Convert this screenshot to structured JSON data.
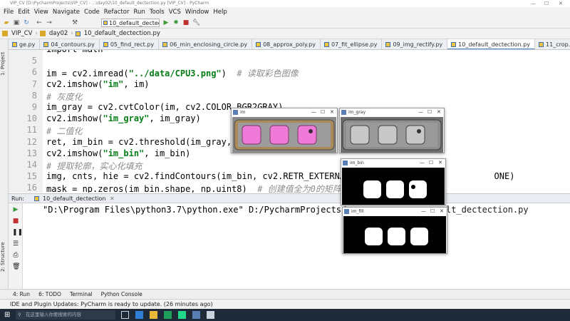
{
  "window": {
    "title": "VIP_CV [D:\\PycharmProjects\\VIP_CV] - ...\\day02\\10_default_dectection.py [VIP_CV] - PyCharm"
  },
  "menu": [
    "File",
    "Edit",
    "View",
    "Navigate",
    "Code",
    "Refactor",
    "Run",
    "Tools",
    "VCS",
    "Window",
    "Help"
  ],
  "toolbar": {
    "run_config": "10_default_dectection"
  },
  "breadcrumb": [
    "VIP_CV",
    "day02",
    "10_default_dectection.py"
  ],
  "tabs": [
    {
      "label": "ge.py",
      "active": false
    },
    {
      "label": "04_contours.py",
      "active": false
    },
    {
      "label": "05_find_rect.py",
      "active": false
    },
    {
      "label": "06_min_enclosing_circle.py",
      "active": false
    },
    {
      "label": "08_approx_poly.py",
      "active": false
    },
    {
      "label": "07_fit_ellipse.py",
      "active": false
    },
    {
      "label": "09_img_rectify.py",
      "active": false
    },
    {
      "label": "10_default_dectection.py",
      "active": true
    },
    {
      "label": "11_crop.py",
      "active": false
    }
  ],
  "left_strip": {
    "project": "1: Project",
    "structure": "2: Structure",
    "favorites": "2: Favorites"
  },
  "editor": {
    "line_numbers": [
      "",
      "5",
      "6",
      "7",
      "8",
      "9",
      "10",
      "11",
      "12",
      "13",
      "14",
      "15",
      "16"
    ],
    "lines": [
      [
        {
          "t": "import math",
          "c": ""
        }
      ],
      [
        {
          "t": "",
          "c": ""
        }
      ],
      [
        {
          "t": "im = cv2.imread(",
          "c": ""
        },
        {
          "t": "\"../data/CPU3.png\"",
          "c": "str"
        },
        {
          "t": ")  ",
          "c": ""
        },
        {
          "t": "# 读取彩色图像",
          "c": "com"
        }
      ],
      [
        {
          "t": "cv2.imshow(",
          "c": ""
        },
        {
          "t": "\"im\"",
          "c": "str"
        },
        {
          "t": ", im)",
          "c": ""
        }
      ],
      [
        {
          "t": "# 灰度化",
          "c": "com"
        }
      ],
      [
        {
          "t": "im_gray = cv2.cvtColor(im, cv2.COLOR_BGR2GRAY)",
          "c": ""
        }
      ],
      [
        {
          "t": "cv2.imshow(",
          "c": ""
        },
        {
          "t": "\"im_gray\"",
          "c": "str"
        },
        {
          "t": ", im_gray)",
          "c": ""
        }
      ],
      [
        {
          "t": "# 二值化",
          "c": "com"
        }
      ],
      [
        {
          "t": "ret, im_bin = cv2.threshold(im_gray, ",
          "c": ""
        }
      ],
      [
        {
          "t": "cv2.imshow(",
          "c": ""
        },
        {
          "t": "\"im_bin\"",
          "c": "str"
        },
        {
          "t": ", im_bin)",
          "c": ""
        }
      ],
      [
        {
          "t": "# 提取轮廓，实心化填充",
          "c": "com"
        }
      ],
      [
        {
          "t": "img, cnts, hie = cv2.findContours(im_bin, cv2.RETR_EXTERNAL",
          "c": ""
        },
        {
          "t": "                            ONE)",
          "c": ""
        }
      ],
      [
        {
          "t": "mask = np.zeros(im_bin.shape, np.uint8)  ",
          "c": ""
        },
        {
          "t": "# 创建值全为0的矩阵,",
          "c": "com"
        }
      ]
    ]
  },
  "run_panel": {
    "label": "Run:",
    "config": "10_default_dectection",
    "command_left": "\"D:\\Program Files\\python3.7\\python.exe\" D:/PycharmProjects/",
    "command_right": "lt_dectection.py"
  },
  "bottom_tabs": [
    "4: Run",
    "6: TODO",
    "Terminal",
    "Python Console"
  ],
  "status": "IDE and Plugin Updates: PyCharm is ready to update. (26 minutes ago)",
  "taskbar": {
    "search_placeholder": "在这里输入你要搜索的内容"
  },
  "image_windows": [
    {
      "title": "im"
    },
    {
      "title": "im_gray"
    },
    {
      "title": "im_bin"
    },
    {
      "title": "im_fill"
    }
  ],
  "colors": {
    "accent": "#4a88c7",
    "string": "#067d17",
    "comment": "#8c8c8c",
    "current_line": "#fdf8dd",
    "taskbar": "#1f2a38"
  }
}
